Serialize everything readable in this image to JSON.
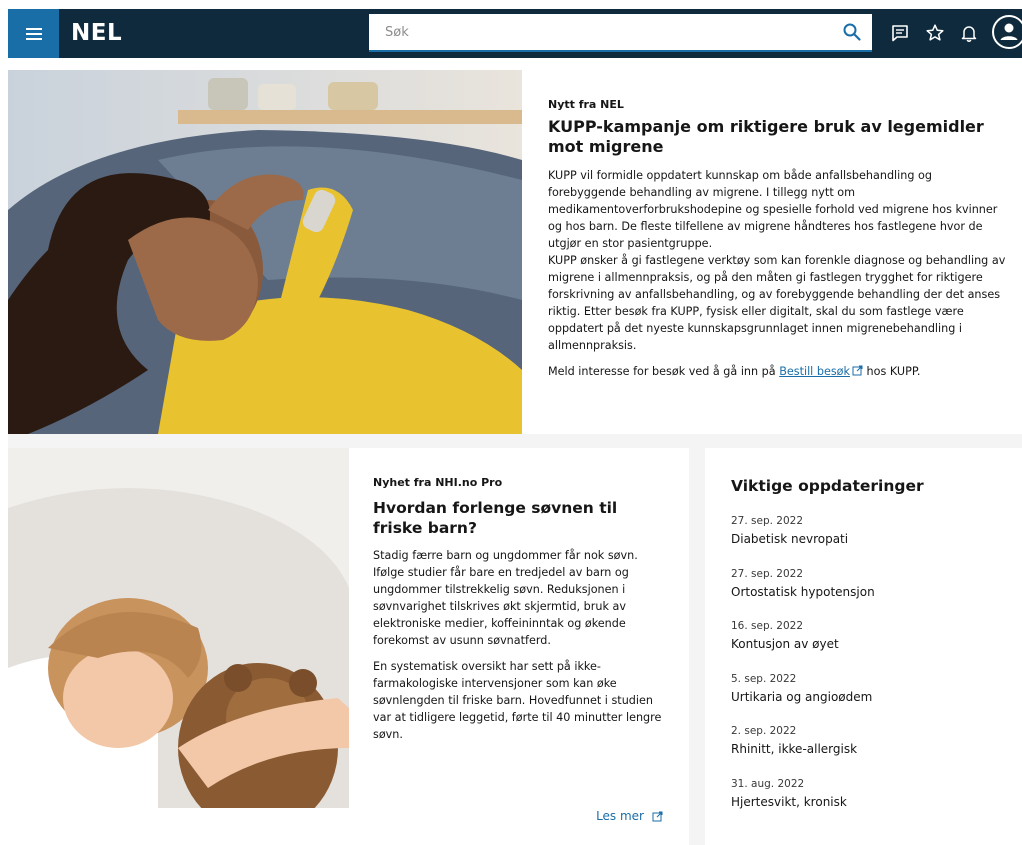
{
  "header": {
    "logo": "NEL",
    "search_placeholder": "Søk",
    "icons": [
      "menu-icon",
      "search-icon",
      "chat-icon",
      "star-icon",
      "bell-icon",
      "user-icon"
    ]
  },
  "hero": {
    "kicker": "Nytt fra NEL",
    "title": "KUPP-kampanje om riktigere bruk av legemidler mot migrene",
    "paragraph1": "KUPP vil formidle oppdatert kunnskap om både anfallsbehandling og forebyggende behandling av migrene. I tillegg nytt om medikamentoverforbrukshodepine og spesielle forhold ved migrene hos kvinner og hos barn. De fleste tilfellene av migrene håndteres hos fastlegene hvor de utgjør en stor pasientgruppe.",
    "paragraph2": "KUPP ønsker å gi fastlegene verktøy som kan forenkle diagnose og behandling av migrene i allmennpraksis, og på den måten gi fastlegen trygghet for riktigere forskrivning av anfallsbehandling, og av forebyggende behandling der det anses riktig. Etter besøk fra KUPP, fysisk eller digitalt, skal du som fastlege være oppdatert på det nyeste kunnskapsgrunnlaget innen migrenebehandling i allmennpraksis.",
    "cta_prefix": "Meld interesse for besøk ved å gå inn på ",
    "cta_link": "Bestill besøk",
    "cta_suffix": " hos KUPP."
  },
  "news": {
    "kicker": "Nyhet fra NHI.no Pro",
    "title": "Hvordan forlenge søvnen til friske barn?",
    "paragraph1": "Stadig færre barn og ungdommer får nok søvn. Ifølge studier får bare en tredjedel av barn og ungdommer tilstrekkelig søvn. Reduksjonen i søvnvarighet tilskrives økt skjermtid, bruk av elektroniske medier, koffeininntak og økende forekomst av usunn søvnatferd.",
    "paragraph2": "En systematisk oversikt har sett på ikke-farmakologiske intervensjoner som kan øke søvnlengden til friske barn. Hovedfunnet i studien var at tidligere leggetid, førte til 40 minutter lengre søvn.",
    "read_more": "Les mer"
  },
  "updates": {
    "title": "Viktige oppdateringer",
    "items": [
      {
        "date": "27. sep. 2022",
        "name": "Diabetisk nevropati"
      },
      {
        "date": "27. sep. 2022",
        "name": "Ortostatisk hypotensjon"
      },
      {
        "date": "16. sep. 2022",
        "name": "Kontusjon av øyet"
      },
      {
        "date": "5. sep. 2022",
        "name": "Urtikaria og angioødem"
      },
      {
        "date": "2. sep. 2022",
        "name": "Rhinitt, ikke-allergisk"
      },
      {
        "date": "31. aug. 2022",
        "name": "Hjertesvikt, kronisk"
      }
    ]
  },
  "colors": {
    "header_bg": "#0f2a3d",
    "menu_bg": "#1a6ea8",
    "link": "#1a6ea8",
    "page_bg": "#f4f4f4"
  }
}
